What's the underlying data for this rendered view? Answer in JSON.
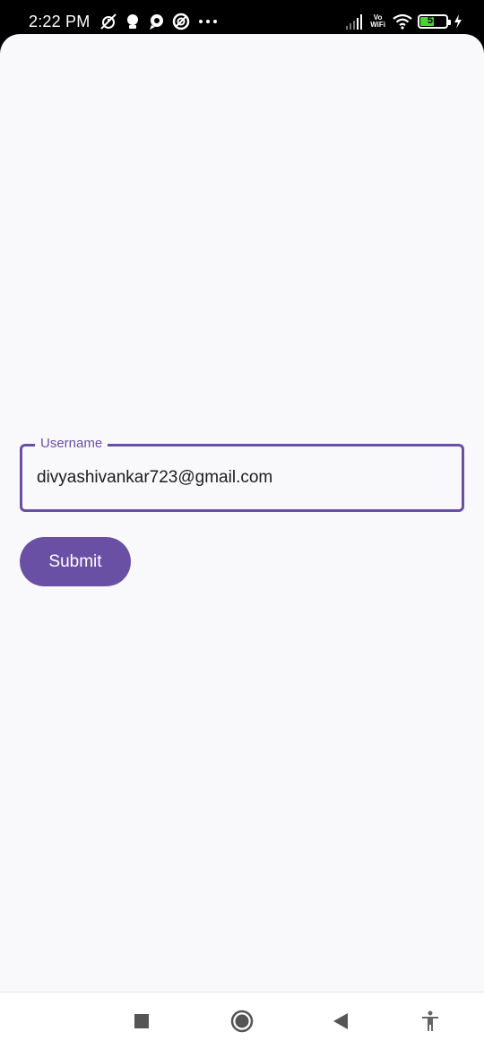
{
  "status_bar": {
    "time": "2:22 PM",
    "left_icons": [
      "alarm-off-icon",
      "notification-icon",
      "chat-bubble-icon",
      "do-not-disturb-icon",
      "more-dots-icon"
    ],
    "network_label_top": "Vo",
    "network_label_bottom": "WiFi",
    "battery_level": "57",
    "battery_percent": 57,
    "charging": true
  },
  "form": {
    "username_label": "Username",
    "username_value": "divyashivankar723@gmail.com",
    "submit_label": "Submit"
  },
  "nav_bar": {
    "buttons": [
      "recents-square-icon",
      "home-circle-icon",
      "back-triangle-icon",
      "accessibility-icon"
    ]
  },
  "colors": {
    "accent": "#6a4fa6",
    "background": "#f9f9fb",
    "status_bar": "#000000",
    "battery_green": "#4cd137"
  }
}
